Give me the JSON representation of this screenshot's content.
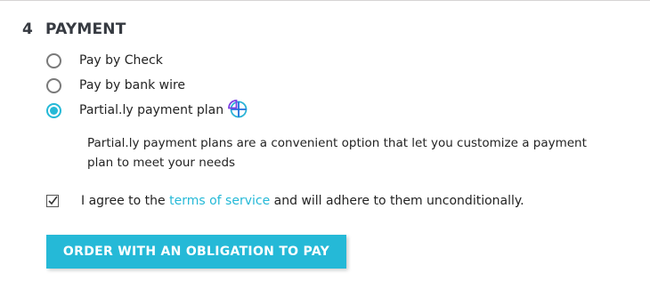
{
  "step": {
    "number": "4",
    "title": "PAYMENT"
  },
  "payment_options": [
    {
      "label": "Pay by Check",
      "selected": false
    },
    {
      "label": "Pay by bank wire",
      "selected": false
    },
    {
      "label": "Partial.ly payment plan",
      "selected": true,
      "icon": "partially-logo-icon"
    }
  ],
  "partial_description": "Partial.ly payment plans are a convenient option that let you customize a payment plan to meet your needs",
  "terms": {
    "checked": true,
    "prefix": "I agree to the ",
    "link_text": "terms of service",
    "suffix": " and will adhere to them unconditionally."
  },
  "order_button_label": "ORDER WITH AN OBLIGATION TO PAY",
  "colors": {
    "accent": "#25b9d7",
    "logo_blue": "#1e6fdc",
    "logo_purple": "#7b3fe4",
    "logo_teal": "#2bb3d6"
  }
}
